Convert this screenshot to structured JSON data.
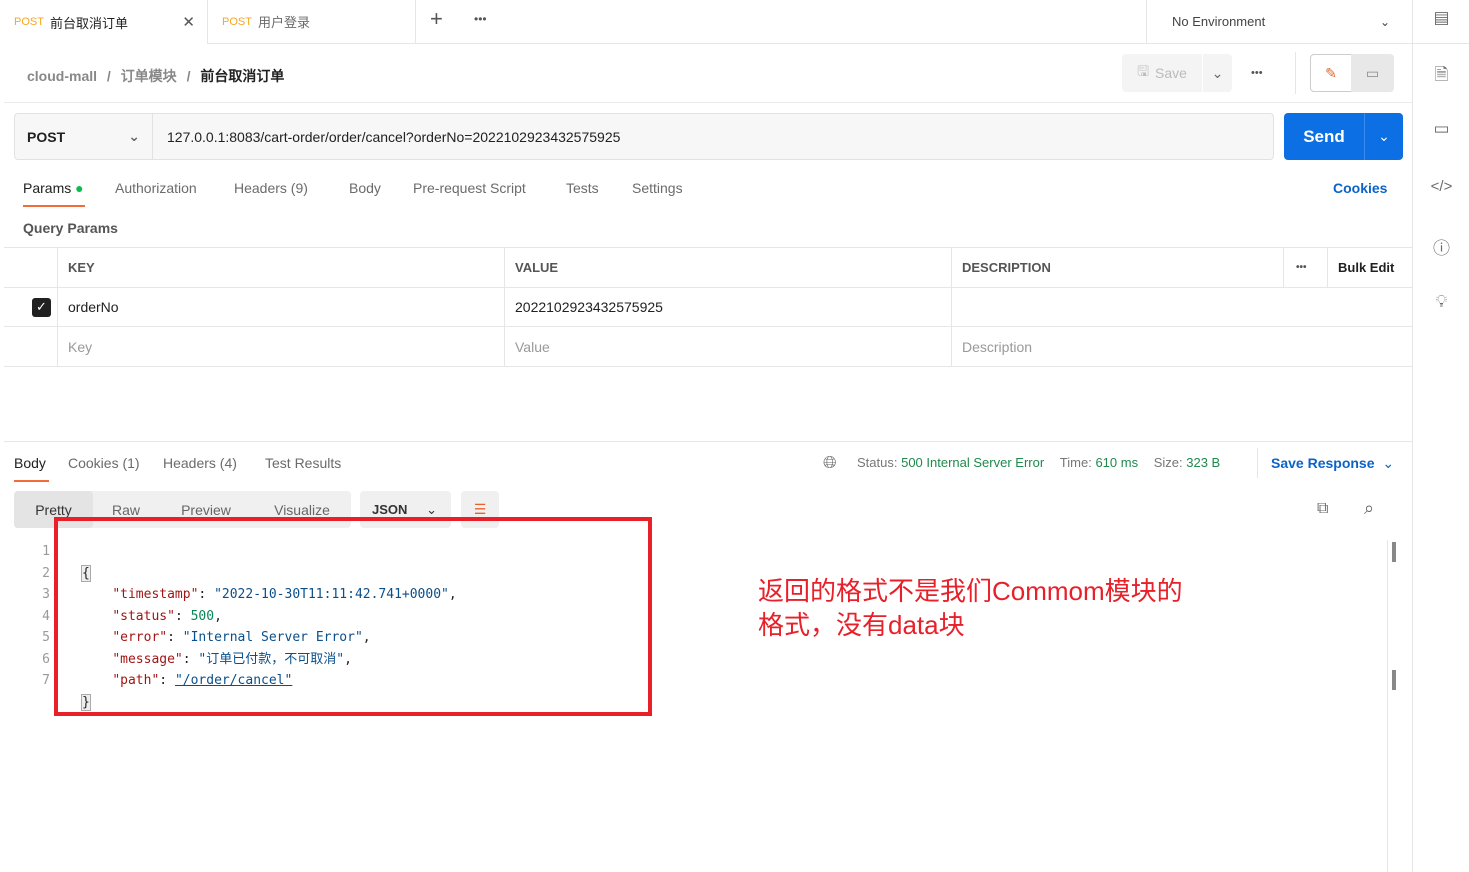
{
  "tabs": [
    {
      "method": "POST",
      "title": "前台取消订单"
    },
    {
      "method": "POST",
      "title": "用户登录"
    }
  ],
  "environment": "No Environment",
  "breadcrumb": [
    "cloud-mall",
    "订单模块",
    "前台取消订单"
  ],
  "save_label": "Save",
  "request": {
    "method": "POST",
    "url": "127.0.0.1:8083/cart-order/order/cancel?orderNo=2022102923432575925",
    "send_label": "Send"
  },
  "request_tabs": [
    "Params",
    "Authorization",
    "Headers (9)",
    "Body",
    "Pre-request Script",
    "Tests",
    "Settings"
  ],
  "cookies_label": "Cookies",
  "query_params_title": "Query Params",
  "table": {
    "headers": [
      "KEY",
      "VALUE",
      "DESCRIPTION"
    ],
    "bulk_edit": "Bulk Edit",
    "rows": [
      {
        "checked": true,
        "key": "orderNo",
        "value": "2022102923432575925"
      }
    ],
    "placeholders": {
      "key": "Key",
      "value": "Value",
      "description": "Description"
    }
  },
  "response": {
    "tabs": [
      "Body",
      "Cookies (1)",
      "Headers (4)",
      "Test Results"
    ],
    "status_label": "Status:",
    "status": "500 Internal Server Error",
    "time_label": "Time:",
    "time": "610 ms",
    "size_label": "Size:",
    "size": "323 B",
    "save_response": "Save Response",
    "views": [
      "Pretty",
      "Raw",
      "Preview",
      "Visualize"
    ],
    "format": "JSON"
  },
  "code": {
    "open": "{",
    "close": "}",
    "lines": [
      {
        "key": "\"timestamp\"",
        "value": "\"2022-10-30T11:11:42.741+0000\""
      },
      {
        "key": "\"status\"",
        "value": "500"
      },
      {
        "key": "\"error\"",
        "value": "\"Internal Server Error\""
      },
      {
        "key": "\"message\"",
        "value": "\"订单已付款，不可取消\""
      },
      {
        "key": "\"path\"",
        "value": "\"/order/cancel\""
      }
    ],
    "line_numbers": [
      "1",
      "2",
      "3",
      "4",
      "5",
      "6",
      "7"
    ]
  },
  "annotation": {
    "line1": "返回的格式不是我们Commom模块的",
    "line2": "格式，没有data块",
    "color": "#e8202a"
  }
}
